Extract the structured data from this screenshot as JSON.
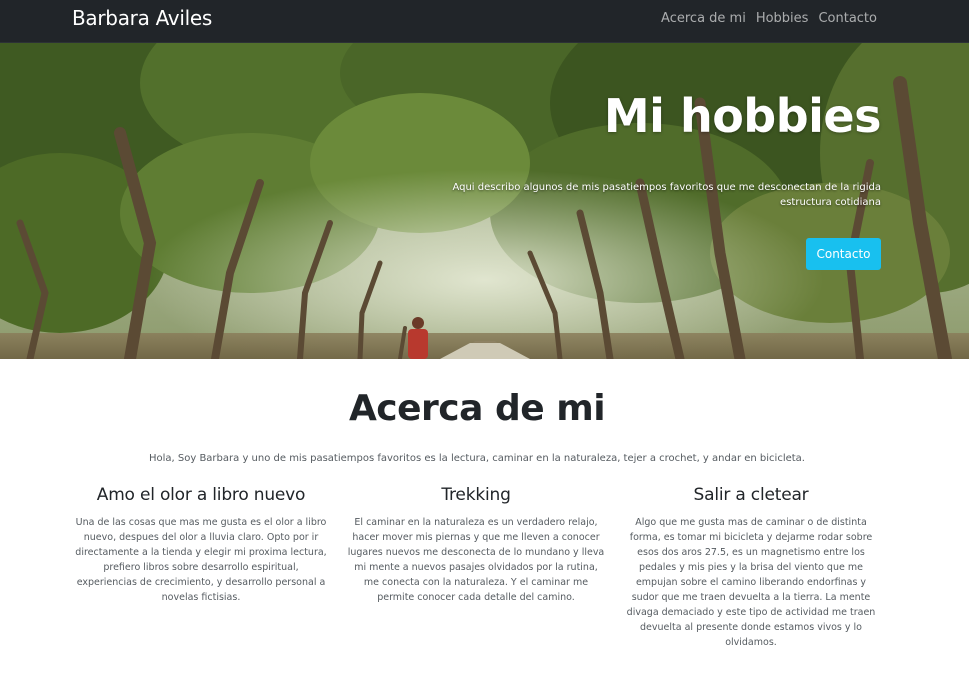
{
  "nav": {
    "brand": "Barbara Aviles",
    "links": [
      "Acerca de mi",
      "Hobbies",
      "Contacto"
    ]
  },
  "hero": {
    "title": "Mi hobbies",
    "subtitle": "Aqui describo algunos de mis pasatiempos favoritos que me desconectan de la rigida estructura cotidiana",
    "button_label": "Contacto",
    "button_color": "#18c0ef"
  },
  "about": {
    "title": "Acerca de mi",
    "intro": "Hola, Soy Barbara y uno de mis pasatiempos favoritos es la lectura, caminar en la naturaleza, tejer a crochet, y andar en bicicleta.",
    "columns": [
      {
        "heading": "Amo el olor a libro nuevo",
        "text": "Una de las cosas que mas me gusta es el olor a libro nuevo, despues del olor a lluvia claro. Opto por ir directamente a la tienda y elegir mi proxima lectura, prefiero libros sobre desarrollo espiritual, experiencias de crecimiento, y desarrollo personal a novelas fictisias."
      },
      {
        "heading": "Trekking",
        "text": "El caminar en la naturaleza es un verdadero relajo, hacer mover mis piernas y que me lleven a conocer lugares nuevos me desconecta de lo mundano y lleva mi mente a nuevos pasajes olvidados por la rutina, me conecta con la naturaleza. Y el caminar me permite conocer cada detalle del camino."
      },
      {
        "heading": "Salir a cletear",
        "text": "Algo que me gusta mas de caminar o de distinta forma, es tomar mi bicicleta y dejarme rodar sobre esos dos aros 27.5, es un magnetismo entre los pedales y mis pies y la brisa del viento que me empujan sobre el camino liberando endorfinas y sudor que me traen devuelta a la tierra. La mente divaga demaciado y este tipo de actividad me traen devuelta al presente donde estamos vivos y lo olvidamos."
      }
    ]
  },
  "colors": {
    "navbar": "#212529",
    "text_dark": "#212529",
    "text_muted": "#555b60"
  }
}
